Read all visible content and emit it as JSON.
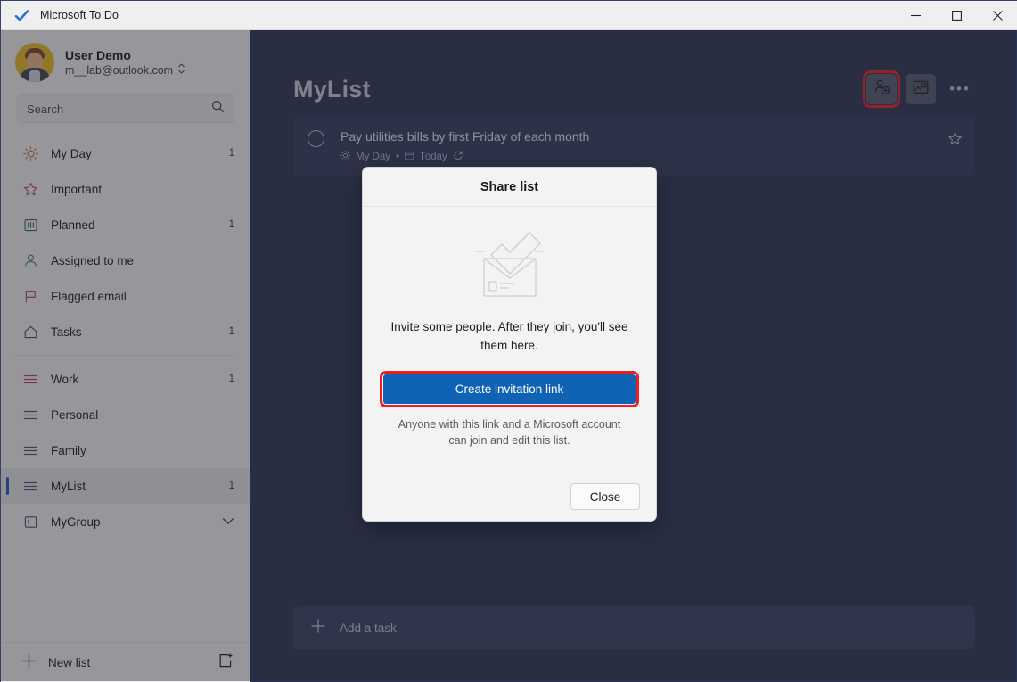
{
  "window": {
    "app_title": "Microsoft To Do",
    "logo_icon": "checkmark-icon",
    "minimize_label": "–",
    "maximize_label": "□",
    "close_label": "✕"
  },
  "sidebar": {
    "account": {
      "name": "User Demo",
      "email": "m__lab@outlook.com",
      "switcher_icon": "chevron-updown-icon",
      "avatar_icon": "user-avatar"
    },
    "search": {
      "placeholder": "Search",
      "icon": "search-icon"
    },
    "smart_lists": [
      {
        "label": "My Day",
        "icon": "sun-icon",
        "count": "1"
      },
      {
        "label": "Important",
        "icon": "star-icon",
        "count": ""
      },
      {
        "label": "Planned",
        "icon": "calendar-icon",
        "count": "1"
      },
      {
        "label": "Assigned to me",
        "icon": "person-icon",
        "count": ""
      },
      {
        "label": "Flagged email",
        "icon": "flag-icon",
        "count": ""
      },
      {
        "label": "Tasks",
        "icon": "home-icon",
        "count": "1"
      }
    ],
    "user_lists": [
      {
        "label": "Work",
        "icon": "list-icon",
        "count": "1",
        "selected": false
      },
      {
        "label": "Personal",
        "icon": "list-icon",
        "count": "",
        "selected": false
      },
      {
        "label": "Family",
        "icon": "list-icon",
        "count": "",
        "selected": false
      },
      {
        "label": "MyList",
        "icon": "list-icon",
        "count": "1",
        "selected": true
      }
    ],
    "group": {
      "label": "MyGroup",
      "icon": "group-icon",
      "chevron": "chevron-down-icon"
    },
    "footer": {
      "new_list_label": "New list",
      "new_list_icon": "plus-icon",
      "new_group_icon": "new-group-icon"
    }
  },
  "main": {
    "list_title": "MyList",
    "actions": {
      "share_icon": "add-person-icon",
      "theme_icon": "background-picture-icon",
      "more_label": "•••"
    },
    "tasks": [
      {
        "title": "Pay utilities bills by first Friday of each month",
        "myday_label": "My Day",
        "myday_icon": "sun-icon",
        "separator": "•",
        "due_label": "Today",
        "due_icon": "calendar-icon",
        "repeat_icon": "repeat-icon",
        "star_icon": "star-outline-icon",
        "checkbox_icon": "circle-icon"
      }
    ],
    "add_task": {
      "label": "Add a task",
      "icon": "plus-icon"
    }
  },
  "dialog": {
    "title": "Share list",
    "illustration_icon": "envelope-check-illustration",
    "body_text": "Invite some people. After they join, you'll see them here.",
    "cta_label": "Create invitation link",
    "note_text": "Anyone with this link and a Microsoft account can join and edit this list.",
    "close_label": "Close"
  },
  "colors": {
    "accent_blue": "#0f62b4",
    "highlight_red": "#ee1c25",
    "main_background": "#2b3353",
    "task_card": "#333b5c",
    "sidebar_background": "#f3f3f3",
    "due_blue": "#9fb8de"
  }
}
